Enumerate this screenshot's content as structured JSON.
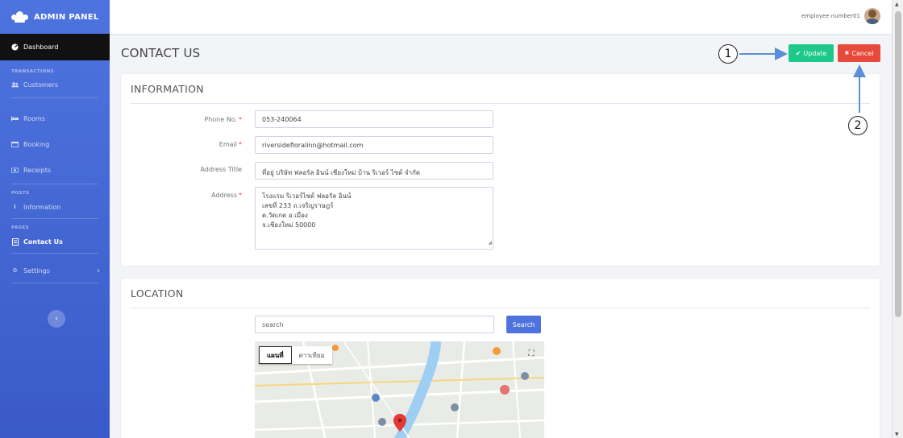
{
  "sidebar": {
    "brand": "ADMIN PANEL",
    "dashboard": "Dashboard",
    "sections": {
      "transactions": "TRANSACTIONS",
      "posts": "POSTS",
      "pages": "PAGES"
    },
    "items": {
      "customers": "Customers",
      "rooms": "Rooms",
      "booking": "Booking",
      "receipts": "Receipts",
      "information": "Information",
      "contact_us": "Contact Us",
      "settings": "Settings"
    },
    "collapse_glyph": "‹",
    "settings_chevron": "›"
  },
  "topbar": {
    "user_name": "employee number01"
  },
  "page": {
    "title": "CONTACT US",
    "update_label": "Update",
    "cancel_label": "Cancel",
    "update_icon": "✔",
    "cancel_icon": "✖"
  },
  "information": {
    "title": "INFORMATION",
    "phone_label": "Phone No.",
    "phone_value": "053-240064",
    "email_label": "Email",
    "email_value": "riversidefloralinn@hotmail.com",
    "address_title_label": "Address Title",
    "address_title_value": "ที่อยู่ บริษัท ฟลอรัล อินน์ เชียงใหม่ บ้าน ริเวอร์ ไซด์ จำกัด",
    "address_label": "Address",
    "address_lines": [
      "โรงแรม ริเวอร์ไซด์ ฟลอรัล อินน์",
      "เลขที่ 233 ถ.เจริญราษฎร์",
      "ต.วัดเกต อ.เมือง",
      "จ.เชียงใหม่ 50000"
    ],
    "required_mark": "*"
  },
  "location": {
    "title": "LOCATION",
    "search_placeholder": "search",
    "search_button": "Search",
    "map_tab_map": "แผนที่",
    "map_tab_satellite": "ดาวเทียม"
  },
  "annotations": [
    "1",
    "2"
  ],
  "colors": {
    "sidebar": "#4e73df",
    "update": "#1cc88a",
    "cancel": "#e74a3b",
    "arrow": "#5b8fd6"
  }
}
